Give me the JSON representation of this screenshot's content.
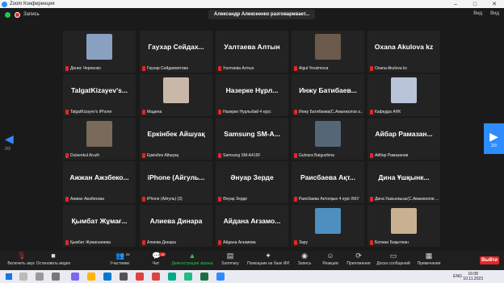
{
  "window": {
    "title": "Zoom Конференция"
  },
  "topbar": {
    "record_label": "Запись",
    "speaker": "Александр Алексеенко разговаривает...",
    "view_1": "Вид",
    "view_2": "Вид"
  },
  "pager": {
    "left": "2/3",
    "right": "2/3"
  },
  "tiles": [
    {
      "big": "",
      "small": "Денис Черненко",
      "photo": "#8aa0c0"
    },
    {
      "big": "Гаухар Сейдах...",
      "small": "Гаухар Сейдахметова"
    },
    {
      "big": "Уалтаева Алтын",
      "small": "Уалтаева Алтын"
    },
    {
      "big": "",
      "small": "Aigul Yessimova",
      "photo": "#6b5a4a"
    },
    {
      "big": "Oxana Akulova kz",
      "small": "Oxana Akulova kz"
    },
    {
      "big": "TalgatKizayev's...",
      "small": "TalgatKizayev's iPhone"
    },
    {
      "big": "",
      "small": "Мадина",
      "photo": "#c9b8a8"
    },
    {
      "big": "Назерке Нұрл...",
      "small": "Назерке Нурлыбай 4 курс"
    },
    {
      "big": "Инжу Батибаев...",
      "small": "Инжу Батибаева(С.Аманжолов а..."
    },
    {
      "big": "",
      "small": "Кафедра АНК",
      "photo": "#b8c4d8"
    },
    {
      "big": "",
      "small": "Duisenkul Aruzh",
      "photo": "#7a6a5a"
    },
    {
      "big": "Еркінбек Айшуақ",
      "small": "Еркінбек Айшуақ"
    },
    {
      "big": "Samsung SM-A...",
      "small": "Samsung SM-A415F"
    },
    {
      "big": "",
      "small": "Gulnara Baigushina",
      "photo": "#556677"
    },
    {
      "big": "Айбар Рамазан...",
      "small": "Айбар Рамазанов"
    },
    {
      "big": "Ажжан Ажзбеко...",
      "small": "Ажжан Ажзбекова"
    },
    {
      "big": "iPhone (Айгуль...",
      "small": "iPhone (Айгуль) (3)"
    },
    {
      "big": "Әнуар Зерде",
      "small": "Әнуар Зерде"
    },
    {
      "big": "Раисбаева Ақт...",
      "small": "Раисбаева Актолқын 4 курс ВКУ"
    },
    {
      "big": "Дина Ұшқынк...",
      "small": "Дина Ушкынкызы(С.Аманжолов ..."
    },
    {
      "big": "Қымбат Жұмағ...",
      "small": "Қымбат Жумагазиева"
    },
    {
      "big": "Алиева Динара",
      "small": "Алиева Динара"
    },
    {
      "big": "Айдана Ағзамо...",
      "small": "Айдана Ағзамова"
    },
    {
      "big": "",
      "small": "Зару",
      "photo": "#4f8fbf"
    },
    {
      "big": "",
      "small": "Батжан Бақытжан",
      "photo": "#c8b090"
    }
  ],
  "toolbar": {
    "mute": "Включить звук",
    "video": "Остановить видео",
    "participants": "Участники",
    "participants_count": "29",
    "chat": "Чат",
    "chat_badge": "19",
    "share": "Демонстрация экрана",
    "summary": "Summary",
    "ai": "Помощник на базе ИИ",
    "record": "Запись",
    "reactions": "Реакции",
    "apps": "Приложения",
    "whiteboard": "Доска сообщений",
    "notes": "Примечания",
    "leave": "Выйти"
  },
  "taskbar": {
    "lang": "ENG",
    "time": "16:08",
    "date": "10.11.2023"
  }
}
